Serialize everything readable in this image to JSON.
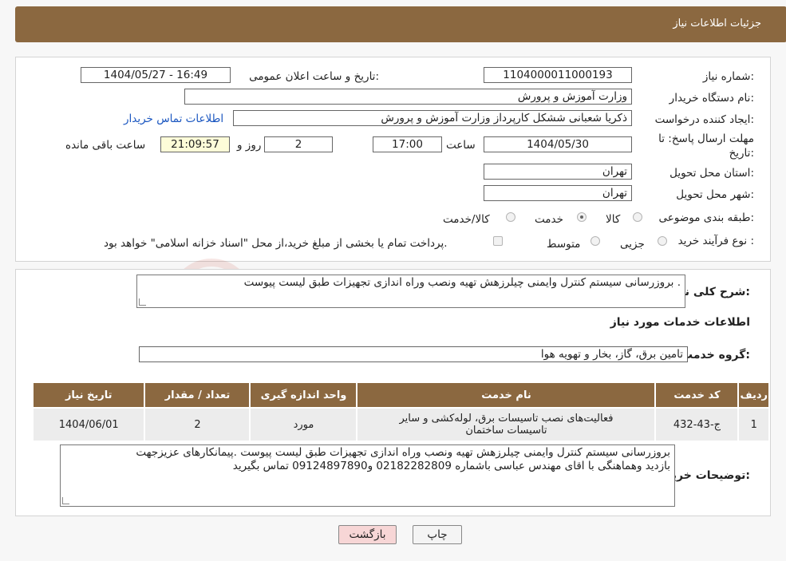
{
  "header": {
    "title": "جزئیات اطلاعات نیاز"
  },
  "details": {
    "need_number_label": "شماره نیاز:",
    "need_number": "1104000011000193",
    "announce_label": "تاریخ و ساعت اعلان عمومی:",
    "announce_value": "1404/05/27 - 16:49",
    "buyer_org_label": "نام دستگاه خریدار:",
    "buyer_org": "وزارت آموزش و پرورش",
    "creator_label": "ایجاد کننده درخواست:",
    "creator": "ذکریا شعبانی ششکل کارپرداز وزارت آموزش و پرورش",
    "contact_link": "اطلاعات تماس خریدار",
    "deadline_label": "مهلت ارسال پاسخ: تا تاریخ:",
    "deadline_date": "1404/05/30",
    "time_label": "ساعت",
    "deadline_time": "17:00",
    "days_value": "2",
    "days_label": "روز و",
    "remaining_time": "21:09:57",
    "remaining_label": "ساعت باقی مانده",
    "province_label": "استان محل تحویل:",
    "province": "تهران",
    "city_label": "شهر محل تحویل:",
    "city": "تهران",
    "category_label": "طبقه بندی موضوعی:",
    "category_options": [
      "کالا",
      "خدمت",
      "کالا/خدمت"
    ],
    "category_selected": "خدمت",
    "process_label": "نوع فرآیند خرید :",
    "process_options": [
      "جزیی",
      "متوسط"
    ],
    "payment_note": "پرداخت تمام یا بخشی از مبلغ خرید،از محل \"اسناد خزانه اسلامی\" خواهد بود."
  },
  "summary": {
    "label": "شرح کلی نیاز:",
    "value": "بروزرسانی سیستم کنترل وایمنی چیلرزهش تهیه ونصب وراه اندازی تجهیزات طبق لیست پیوست ."
  },
  "services": {
    "section_title": "اطلاعات خدمات مورد نیاز",
    "group_label": "گروه خدمت:",
    "group_value": "تامین برق، گاز، بخار و تهویه هوا",
    "columns": [
      "ردیف",
      "کد خدمت",
      "نام خدمت",
      "واحد اندازه گیری",
      "تعداد / مقدار",
      "تاریخ نیاز"
    ],
    "rows": [
      {
        "row": "1",
        "code": "ج-43-432",
        "name": "فعالیت‌های نصب تاسیسات برق، لوله‌کشی و سایر تاسیسات ساختمان",
        "unit": "مورد",
        "qty": "2",
        "date": "1404/06/01"
      }
    ]
  },
  "buyer_notes": {
    "label": "توضیحات خریدار:",
    "line1": "بروزرسانی سیستم کنترل وایمنی چیلرزهش تهیه ونصب وراه اندازی تجهیزات طبق لیست پیوست .پیمانکارهای عزیزجهت",
    "line2": "بازدید وهماهنگی با اقای مهندس عباسی باشماره 02182282809    و09124897890 تماس بگیرید"
  },
  "buttons": {
    "print": "چاپ",
    "back": "بازگشت"
  },
  "colors": {
    "header": "#8b6840",
    "back_button": "#f7d6d6",
    "link": "#1a56c0"
  }
}
